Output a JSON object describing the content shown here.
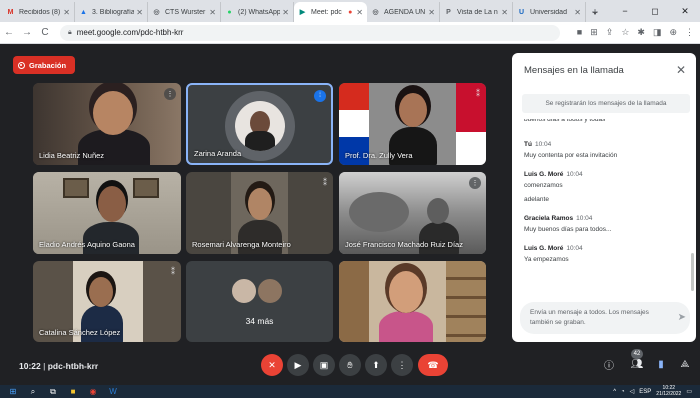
{
  "browser": {
    "tabs": [
      {
        "label": "Recibidos (8)",
        "color": "#d93025",
        "glyph": "M",
        "active": false
      },
      {
        "label": "3. Bibliografía",
        "color": "#1a73e8",
        "glyph": "▲",
        "active": false
      },
      {
        "label": "CTS Wurster",
        "color": "#5f6368",
        "glyph": "◎",
        "active": false
      },
      {
        "label": "(2) WhatsApp",
        "color": "#25d366",
        "glyph": "●",
        "active": false
      },
      {
        "label": "Meet: pdc",
        "color": "#00897b",
        "glyph": "▶",
        "active": true
      },
      {
        "label": "AGENDA UN",
        "color": "#5f6368",
        "glyph": "◎",
        "active": false
      },
      {
        "label": "Vista de La n",
        "color": "#5f6368",
        "glyph": "P",
        "active": false
      },
      {
        "label": "Universidad",
        "color": "#1565c0",
        "glyph": "U",
        "active": false
      }
    ],
    "new_tab": "+",
    "url": "meet.google.com/pdc-htbh-krr",
    "window_controls": [
      "⌄",
      "−",
      "◻",
      "✕"
    ]
  },
  "meet": {
    "recording_label": "Grabación",
    "tiles": [
      {
        "name": "Lidia Beatriz Nuñez"
      },
      {
        "name": "Zarina Aranda"
      },
      {
        "name": "Prof. Dra. Zully Vera"
      },
      {
        "name": "Eladio Andrés Aquino Gaona"
      },
      {
        "name": "Rosemari Alvarenga Monteiro"
      },
      {
        "name": "José Francisco Machado Ruiz Díaz"
      },
      {
        "name": "Catalina Sánchez López"
      },
      {
        "name": "34 más"
      },
      {
        "name": ""
      }
    ],
    "meeting_time": "10:22",
    "meeting_code": "pdc-htbh-krr",
    "participants_count": "42"
  },
  "chat": {
    "title": "Mensajes en la llamada",
    "notice": "Se registrarán los mensajes de la llamada",
    "cut_text": "buenos días a todos y todas",
    "messages": [
      {
        "sender": "Tú",
        "time": "10:04",
        "lines": [
          "Muy contenta por esta invitación"
        ]
      },
      {
        "sender": "Luis G. Moré",
        "time": "10:04",
        "lines": [
          "comenzamos",
          "adelante"
        ]
      },
      {
        "sender": "Graciela Ramos",
        "time": "10:04",
        "lines": [
          "Muy buenos días para todos..."
        ]
      },
      {
        "sender": "Luis G. Moré",
        "time": "10:04",
        "lines": [
          "Ya empezamos"
        ]
      }
    ],
    "input_placeholder": "Envía un mensaje a todos. Los mensajes también se graban."
  },
  "taskbar": {
    "lang": "ESP",
    "time": "10:22",
    "date": "21/12/2022"
  }
}
